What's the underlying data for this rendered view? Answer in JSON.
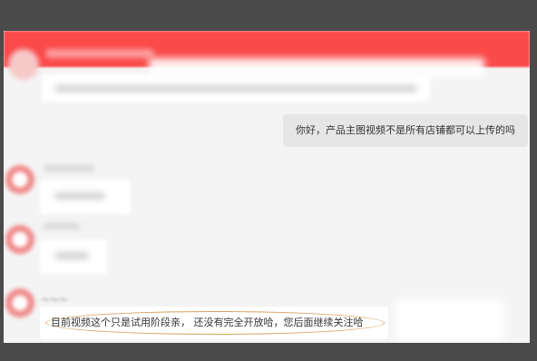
{
  "chat": {
    "outgoing_message": "你好，产品主图视频不是所有店铺都可以上传的吗",
    "reply_message": "目前视频这个只是试用阶段亲， 还没有完全开放哈，您后面继续关注哈"
  },
  "colors": {
    "header": "#fa4a4a",
    "highlight_ring": "#d9a061"
  },
  "icons": {
    "avatar": "avatar-icon"
  }
}
